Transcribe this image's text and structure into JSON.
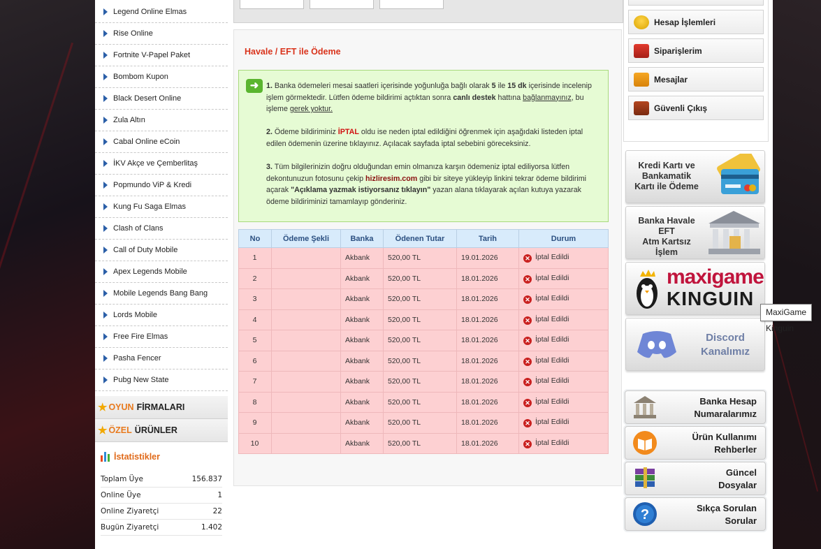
{
  "left_sidebar": {
    "games": [
      "Legend Online Elmas",
      "Rise Online",
      "Fortnite V-Papel Paket",
      "Bombom Kupon",
      "Black Desert Online",
      "Zula Altın",
      "Cabal Online eCoin",
      "İKV Akçe ve Çemberlitaş",
      "Popmundo ViP & Kredi",
      "Kung Fu Saga Elmas",
      "Clash of Clans",
      "Call of Duty Mobile",
      "Apex Legends Mobile",
      "Mobile Legends Bang Bang",
      "Lords Mobile",
      "Free Fire Elmas",
      "Pasha Fencer",
      "Pubg New State"
    ],
    "categories": [
      {
        "accent": "OYUN",
        "rest": "FİRMALARI"
      },
      {
        "accent": "ÖZEL",
        "rest": "ÜRÜNLER"
      }
    ],
    "stats": {
      "title": "İstatistikler",
      "rows": [
        {
          "label": "Toplam Üye",
          "value": "156.837"
        },
        {
          "label": "Online Üye",
          "value": "1"
        },
        {
          "label": "Online Ziyaretçi",
          "value": "22"
        },
        {
          "label": "Bugün Ziyaretçi",
          "value": "1.402"
        }
      ]
    }
  },
  "main": {
    "title": "Havale / EFT ile Ödeme",
    "info": {
      "p1_num": "1.",
      "p1_a": "Banka ödemeleri mesai saatleri içerisinde yoğunluğa bağlı olarak",
      "p1_b1": "5",
      "p1_b": "ile",
      "p1_b2": "15 dk",
      "p1_c": "içerisinde incelenip işlem görmektedir. Lütfen ödeme bildirimi açtıktan sonra",
      "p1_b3": "canlı destek",
      "p1_d": "hattına",
      "p1_u1": "bağlanmayınız",
      "p1_e": ", bu işleme",
      "p1_u2": "gerek yoktur.",
      "p2_num": "2.",
      "p2_a": "Ödeme bildiriminiz",
      "p2_red": "İPTAL",
      "p2_b": "oldu ise neden iptal edildiğini öğrenmek için aşağıdaki listeden iptal edilen ödemenin üzerine tıklayınız. Açılacak sayfada iptal sebebini göreceksiniz.",
      "p3_num": "3.",
      "p3_a": "Tüm bilgilerinizin doğru olduğundan emin olmanıza karşın ödemeniz iptal ediliyorsa lütfen dekontunuzun fotosunu çekip",
      "p3_site": "hizliresim.com",
      "p3_b": "gibi bir siteye yükleyip linkini tekrar ödeme bildirimi açarak",
      "p3_q": "\"Açıklama yazmak istiyorsanız tıklayın\"",
      "p3_c": "yazan alana tıklayarak açılan kutuya yazarak ödeme bildiriminizi tamamlayıp gönderiniz."
    },
    "table": {
      "headers": [
        "No",
        "Ödeme Şekli",
        "Banka",
        "Ödenen Tutar",
        "Tarih",
        "Durum"
      ],
      "rows": [
        {
          "no": "1",
          "method": "",
          "bank": "Akbank",
          "amount": "520,00 TL",
          "date": "19.01.2026",
          "status": "İptal Edildi"
        },
        {
          "no": "2",
          "method": "",
          "bank": "Akbank",
          "amount": "520,00 TL",
          "date": "18.01.2026",
          "status": "İptal Edildi"
        },
        {
          "no": "3",
          "method": "",
          "bank": "Akbank",
          "amount": "520,00 TL",
          "date": "18.01.2026",
          "status": "İptal Edildi"
        },
        {
          "no": "4",
          "method": "",
          "bank": "Akbank",
          "amount": "520,00 TL",
          "date": "18.01.2026",
          "status": "İptal Edildi"
        },
        {
          "no": "5",
          "method": "",
          "bank": "Akbank",
          "amount": "520,00 TL",
          "date": "18.01.2026",
          "status": "İptal Edildi"
        },
        {
          "no": "6",
          "method": "",
          "bank": "Akbank",
          "amount": "520,00 TL",
          "date": "18.01.2026",
          "status": "İptal Edildi"
        },
        {
          "no": "7",
          "method": "",
          "bank": "Akbank",
          "amount": "520,00 TL",
          "date": "18.01.2026",
          "status": "İptal Edildi"
        },
        {
          "no": "8",
          "method": "",
          "bank": "Akbank",
          "amount": "520,00 TL",
          "date": "18.01.2026",
          "status": "İptal Edildi"
        },
        {
          "no": "9",
          "method": "",
          "bank": "Akbank",
          "amount": "520,00 TL",
          "date": "18.01.2026",
          "status": "İptal Edildi"
        },
        {
          "no": "10",
          "method": "",
          "bank": "Akbank",
          "amount": "520,00 TL",
          "date": "18.01.2026",
          "status": "İptal Edildi"
        }
      ]
    }
  },
  "right_sidebar": {
    "menu": [
      {
        "label": "Hesap İşlemleri",
        "icon": "coins-icon"
      },
      {
        "label": "Siparişlerim",
        "icon": "cart-icon"
      },
      {
        "label": "Mesajlar",
        "icon": "mail-icon"
      },
      {
        "label": "Güvenli Çıkış",
        "icon": "exit-icon"
      }
    ],
    "banners": {
      "card": "Kredi Kartı ve Bankamatik Kartı ile Ödeme",
      "bank_l1": "Banka Havale",
      "bank_l2": "EFT",
      "bank_l3": "Atm Kartsız İşlem",
      "maxi_1": "maxigame",
      "maxi_2": "KINGUIN",
      "discord_1": "Discord",
      "discord_2": "Kanalımız"
    },
    "links": [
      {
        "l1": "Banka Hesap",
        "l2": "Numaralarımız"
      },
      {
        "l1": "Ürün Kullanımı",
        "l2": "Rehberler"
      },
      {
        "l1": "Güncel",
        "l2": "Dosyalar"
      },
      {
        "l1": "Sıkça Sorulan",
        "l2": "Sorular"
      }
    ],
    "tooltip": "MaxiGame Kinguin"
  },
  "colors": {
    "accent_red": "#d9331b",
    "info_bg": "#e6fbd4",
    "row_bg": "#fdd0d2",
    "header_bg": "#d8ebfb"
  }
}
